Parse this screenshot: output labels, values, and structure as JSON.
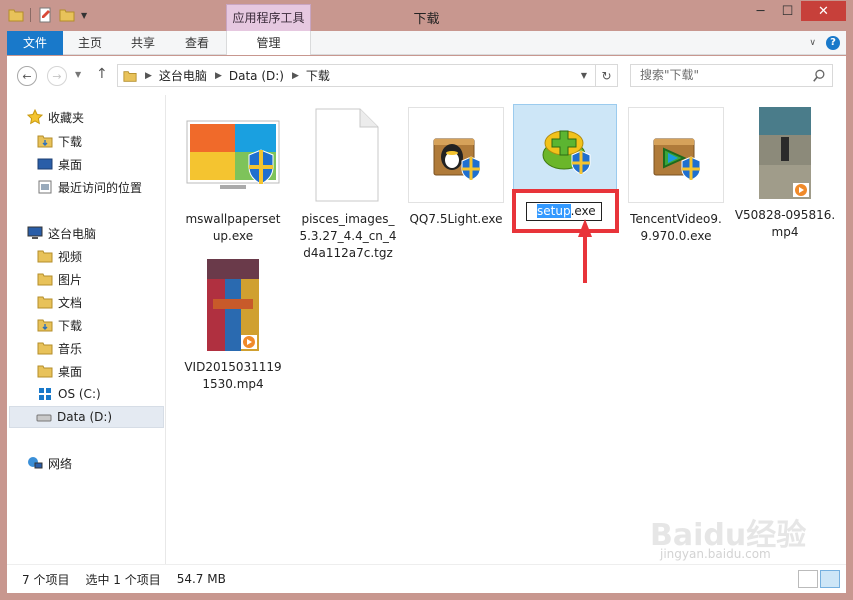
{
  "window": {
    "title": "下载"
  },
  "ribbon": {
    "context_tab": "应用程序工具",
    "tabs": [
      "文件",
      "主页",
      "共享",
      "查看",
      "管理"
    ]
  },
  "address": {
    "crumbs": [
      "这台电脑",
      "Data (D:)",
      "下载"
    ],
    "search_placeholder": "搜索\"下载\""
  },
  "nav": {
    "favorites_label": "收藏夹",
    "favorites": [
      "下载",
      "桌面",
      "最近访问的位置"
    ],
    "pc_label": "这台电脑",
    "pc_items": [
      "视频",
      "图片",
      "文档",
      "下载",
      "音乐",
      "桌面",
      "OS (C:)",
      "Data (D:)"
    ],
    "network_label": "网络"
  },
  "files": [
    {
      "name": "mswallpapersetup.exe",
      "display": "mswallpaperset\nup.exe",
      "icon": "wallpaper-installer-icon"
    },
    {
      "name": "pisces_images_5.3.27_4.4_cn_4d4a112a7c.tgz",
      "display": "pisces_images_\n5.3.27_4.4_cn_4\nd4a112a7c.tgz",
      "icon": "generic-file-icon"
    },
    {
      "name": "QQ7.5Light.exe",
      "display": "QQ7.5Light.exe",
      "icon": "qq-installer-icon"
    },
    {
      "name": "setup.exe",
      "display": "setup.exe",
      "icon": "setup-installer-icon",
      "renaming": true,
      "rename_selected": "setup",
      "rename_rest": ".exe"
    },
    {
      "name": "TencentVideo9.9.970.0.exe",
      "display": "TencentVideo9.\n9.970.0.exe",
      "icon": "tencent-video-icon"
    },
    {
      "name": "V50828-095816.mp4",
      "display": "V50828-095816.\nmp4",
      "icon": "video-thumbnail"
    },
    {
      "name": "VID20150311191530.mp4",
      "display": "VID2015031119\n1530.mp4",
      "icon": "video-thumbnail"
    }
  ],
  "status": {
    "count": "7 个项目",
    "selected": "选中 1 个项目",
    "size": "54.7 MB"
  },
  "watermark": {
    "text": "Baidu经验",
    "sub": "jingyan.baidu.com"
  },
  "colors": {
    "accent": "#1979ca",
    "annotation": "#e8343a",
    "selection": "#cde6f7"
  }
}
